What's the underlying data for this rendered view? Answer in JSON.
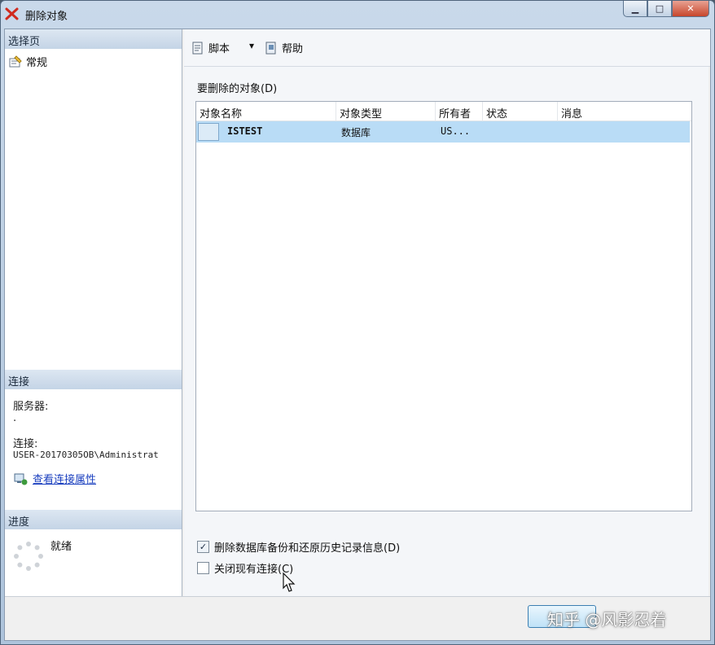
{
  "window": {
    "title": "删除对象",
    "buttons": {
      "minimize": "▁",
      "maximize": "□",
      "close": "✕"
    }
  },
  "left": {
    "select_page_header": "选择页",
    "nav_items": [
      {
        "label": "常规",
        "icon": "general-page-icon"
      }
    ],
    "connection_header": "连接",
    "server_label": "服务器:",
    "server_value": ".",
    "connection_label": "连接:",
    "connection_value": "USER-20170305OB\\Administrat",
    "view_connection_link": "查看连接属性",
    "progress_header": "进度",
    "progress_status": "就绪"
  },
  "toolbar": {
    "script_label": "脚本",
    "dropdown_arrow": "▾",
    "help_label": "帮助"
  },
  "content": {
    "objects_label": "要删除的对象(D)",
    "columns": [
      "对象名称",
      "对象类型",
      "所有者",
      "状态",
      "消息"
    ],
    "rows": [
      {
        "name": "ISTEST",
        "type": "数据库",
        "owner": "US...",
        "status": "",
        "message": ""
      }
    ],
    "checkbox_delete_history": {
      "label": "删除数据库备份和还原历史记录信息(D)",
      "checked": true
    },
    "checkbox_close_connections": {
      "label": "关闭现有连接(C)",
      "checked": false
    }
  },
  "footer": {
    "watermark": "知乎 @风影忍着"
  },
  "colors": {
    "selection": "#b9dcf6",
    "link": "#1a3fbf",
    "section_header": "#c4d4e6"
  }
}
